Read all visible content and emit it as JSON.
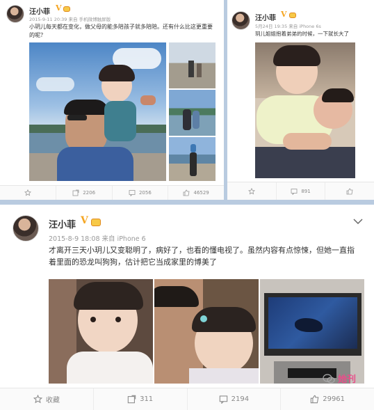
{
  "posts": [
    {
      "author": "汪小菲",
      "meta": "2015-9-11 20:39 来自 手机微博触屏版",
      "text": "小玥儿每天都在变化，做父母的能多陪孩子就多陪陪。还有什么比这更重要的呢？",
      "actions": {
        "repost": "2206",
        "comment": "2056",
        "like": "46529"
      }
    },
    {
      "author": "汪小菲",
      "meta": "5月24日 19:35 来自 iPhone 6s",
      "text": "玥儿姐姐抱着弟弟的时候，一下就长大了",
      "actions": {
        "comment": "891"
      }
    },
    {
      "author": "汪小菲",
      "meta": "2015-8-9 18:08 来自 iPhone 6",
      "text": "才离开三天小玥儿又变聪明了，病好了，也看的懂电视了。虽然内容有点惊悚，但她一直指着里面的恐龙叫狗狗，估计把它当成家里的博美了",
      "actions": {
        "favorite": "收藏",
        "repost": "311",
        "comment": "2194",
        "like": "29961"
      }
    }
  ],
  "watermark": "她刊",
  "colors": {
    "accent_orange": "#f5a623",
    "watermark_pink": "#e94e8a",
    "text": "#333333",
    "meta": "#999999"
  }
}
